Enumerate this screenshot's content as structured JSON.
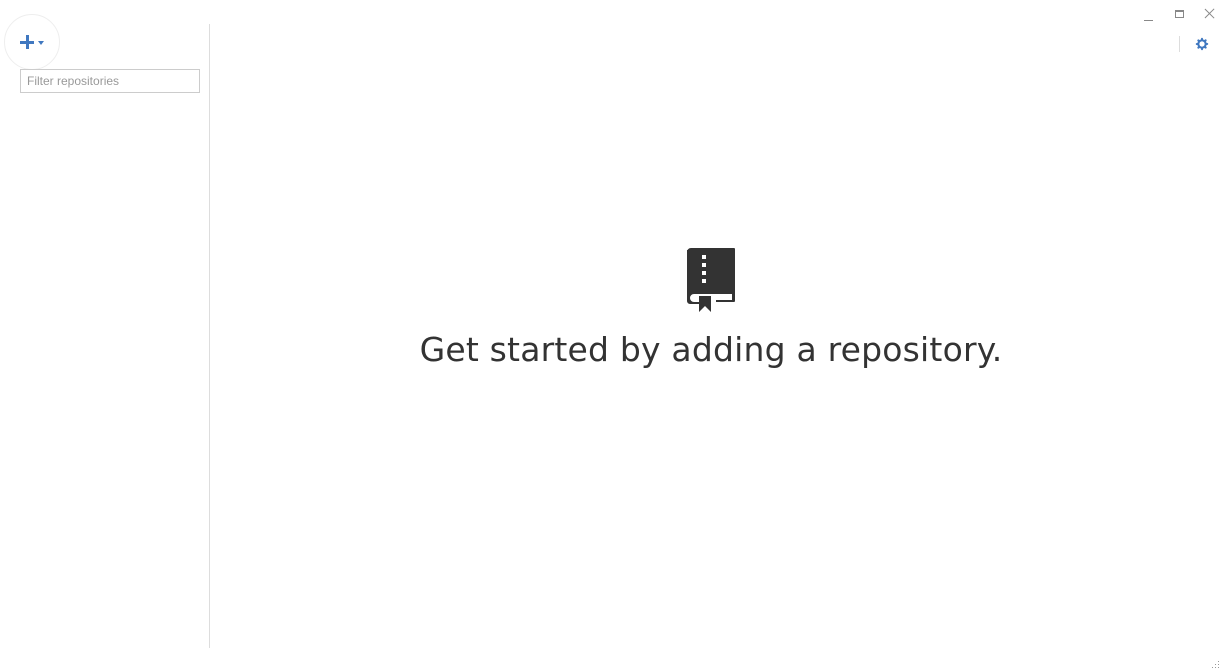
{
  "sidebar": {
    "add_menu": {
      "icon": "plus-icon",
      "caret_icon": "caret-down-icon"
    },
    "filter": {
      "value": "",
      "placeholder": "Filter repositories"
    }
  },
  "window_controls": {
    "minimize_icon": "minimize-icon",
    "maximize_icon": "maximize-icon",
    "close_icon": "close-icon"
  },
  "toolbar": {
    "settings_icon": "gear-icon"
  },
  "empty_state": {
    "icon": "repo-book-icon",
    "message": "Get started by adding a repository."
  },
  "colors": {
    "accent": "#4078c0",
    "text": "#333333",
    "divider": "#dddddd"
  }
}
